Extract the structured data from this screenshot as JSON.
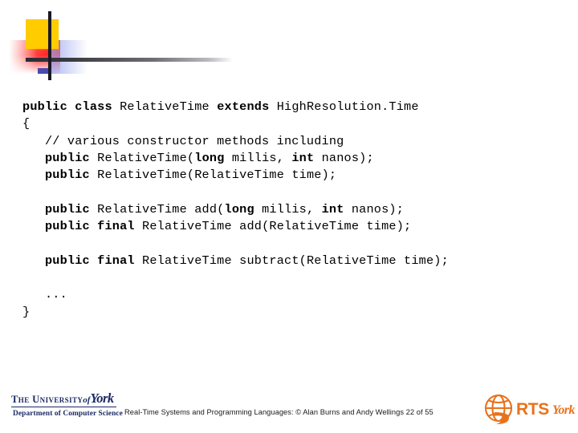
{
  "slide": {
    "title_graphic": "decorative-bars",
    "colors": {
      "yellow": "#FFCC00",
      "red": "#FF2B2B",
      "blue": "#4A4AB0",
      "dark_bar": "#1A1A24",
      "york_navy": "#1B2A63",
      "rts_orange": "#E8721C"
    }
  },
  "code": {
    "language": "java",
    "lines": [
      [
        {
          "t": "public class ",
          "b": true
        },
        {
          "t": "RelativeTime ",
          "b": false
        },
        {
          "t": "extends ",
          "b": true
        },
        {
          "t": "HighResolution.Time",
          "b": false
        }
      ],
      [
        {
          "t": "{",
          "b": false
        }
      ],
      [
        {
          "t": "   // various constructor methods including",
          "b": false
        }
      ],
      [
        {
          "t": "   ",
          "b": false
        },
        {
          "t": "public ",
          "b": true
        },
        {
          "t": "RelativeTime(",
          "b": false
        },
        {
          "t": "long ",
          "b": true
        },
        {
          "t": "millis, ",
          "b": false
        },
        {
          "t": "int ",
          "b": true
        },
        {
          "t": "nanos);",
          "b": false
        }
      ],
      [
        {
          "t": "   ",
          "b": false
        },
        {
          "t": "public ",
          "b": true
        },
        {
          "t": "RelativeTime(RelativeTime time);",
          "b": false
        }
      ],
      [
        {
          "t": "",
          "b": false
        }
      ],
      [
        {
          "t": "   ",
          "b": false
        },
        {
          "t": "public ",
          "b": true
        },
        {
          "t": "RelativeTime add(",
          "b": false
        },
        {
          "t": "long ",
          "b": true
        },
        {
          "t": "millis, ",
          "b": false
        },
        {
          "t": "int ",
          "b": true
        },
        {
          "t": "nanos);",
          "b": false
        }
      ],
      [
        {
          "t": "   ",
          "b": false
        },
        {
          "t": "public final ",
          "b": true
        },
        {
          "t": "RelativeTime add(RelativeTime time);",
          "b": false
        }
      ],
      [
        {
          "t": "",
          "b": false
        }
      ],
      [
        {
          "t": "   ",
          "b": false
        },
        {
          "t": "public final ",
          "b": true
        },
        {
          "t": "RelativeTime subtract(RelativeTime time);",
          "b": false
        }
      ],
      [
        {
          "t": "",
          "b": false
        }
      ],
      [
        {
          "t": "   ...",
          "b": false
        }
      ],
      [
        {
          "t": "}",
          "b": false
        }
      ]
    ]
  },
  "footer": {
    "note": "Real-Time Systems and Programming Languages: © Alan Burns and Andy Wellings 22 of 55",
    "york_logo": {
      "the": "The",
      "university": "University",
      "of": "of",
      "york": "York",
      "department": "Department of Computer Science"
    },
    "rts_logo": {
      "acronym": "RTS",
      "york": "York"
    }
  }
}
